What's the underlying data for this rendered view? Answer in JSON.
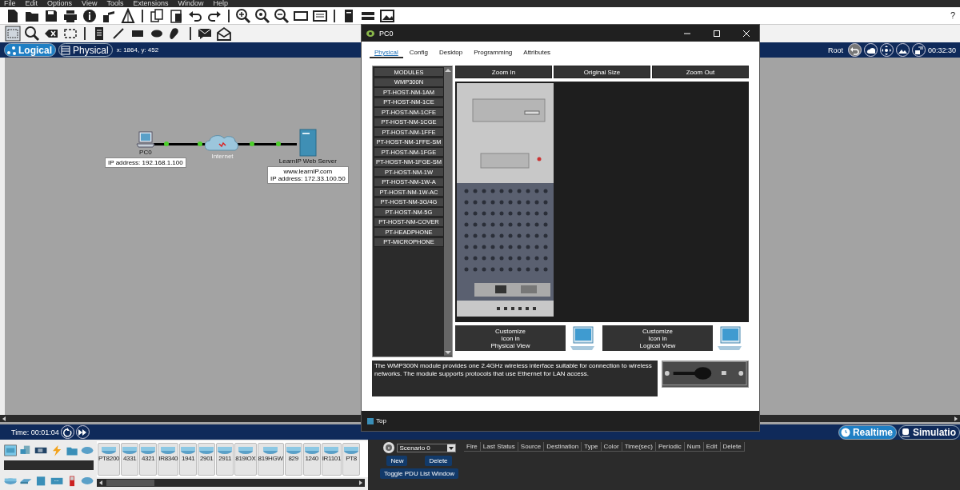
{
  "menu_bar": [
    "File",
    "Edit",
    "Options",
    "View",
    "Tools",
    "Extensions",
    "Window",
    "Help"
  ],
  "help_button": "?",
  "workspace_tabs": [
    {
      "label": "Logical",
      "selected": true
    },
    {
      "label": "Physical",
      "selected": false
    }
  ],
  "cursor_coords": "x: 1864, y: 452",
  "root_label": "Root",
  "clock": "00:32:30",
  "topology": {
    "devices": [
      {
        "kind": "pc",
        "name": "PC0",
        "note": "IP address: 192.168.1.100"
      },
      {
        "kind": "cloud",
        "name": "Internet"
      },
      {
        "kind": "server",
        "name": "LearnIP Web Server",
        "note": "www.learnIP.com\nIP address: 172.33.100.50"
      }
    ]
  },
  "time": "Time: 00:01:04",
  "modes": [
    {
      "label": "Realtime",
      "selected": true
    },
    {
      "label": "Simulatio",
      "selected": false
    }
  ],
  "device_models": [
    "PT8200",
    "4331",
    "4321",
    "IR8340",
    "1941",
    "2901",
    "2911",
    "819IOX",
    "819HGW",
    "829",
    "1240",
    "IR1101",
    "PT8"
  ],
  "scenario": {
    "value": "Scenario 0"
  },
  "scenario_buttons": [
    "New",
    "Delete",
    "Toggle PDU List Window"
  ],
  "pdu_columns": [
    "Fire",
    "Last Status",
    "Source",
    "Destination",
    "Type",
    "Color",
    "Time(sec)",
    "Periodic",
    "Num",
    "Edit",
    "Delete"
  ],
  "dialog": {
    "title": "PC0",
    "tabs": [
      {
        "label": "Physical",
        "selected": true
      },
      {
        "label": "Config",
        "selected": false
      },
      {
        "label": "Desktop",
        "selected": false
      },
      {
        "label": "Programming",
        "selected": false
      },
      {
        "label": "Attributes",
        "selected": false
      }
    ],
    "modules_header": "MODULES",
    "modules": [
      "WMP300N",
      "PT-HOST-NM-1AM",
      "PT-HOST-NM-1CE",
      "PT-HOST-NM-1CFE",
      "PT-HOST-NM-1CGE",
      "PT-HOST-NM-1FFE",
      "PT-HOST-NM-1FFE-SM",
      "PT-HOST-NM-1FGE",
      "PT-HOST-NM-1FGE-SM",
      "PT-HOST-NM-1W",
      "PT-HOST-NM-1W-A",
      "PT-HOST-NM-1W-AC",
      "PT-HOST-NM-3G/4G",
      "PT-HOST-NM-5G",
      "PT-HOST-NM-COVER",
      "PT-HEADPHONE",
      "PT-MICROPHONE"
    ],
    "zoom_buttons": [
      "Zoom In",
      "Original Size",
      "Zoom Out"
    ],
    "customize_buttons": [
      "Customize\nIcon in\nPhysical View",
      "Customize\nIcon in\nLogical View"
    ],
    "description": "The WMP300N module provides one 2.4GHz wireless interface suitable for connection to wireless networks. The module supports protocols that use Ethernet for LAN access.",
    "footer": "Top"
  }
}
